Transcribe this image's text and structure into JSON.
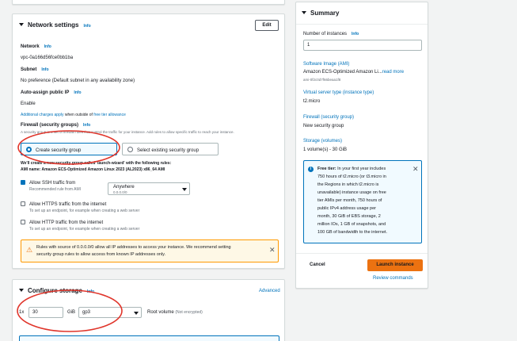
{
  "network": {
    "title": "Network settings",
    "info": "Info",
    "edit_label": "Edit",
    "network_label": "Network",
    "network_value": "vpc-0a166d56fce0bb1ba",
    "subnet_label": "Subnet",
    "subnet_value": "No preference (Default subnet in any availability zone)",
    "public_ip_label": "Auto-assign public IP",
    "public_ip_value": "Enable",
    "charges_link": "Additional charges apply",
    "charges_text": "when outside of",
    "free_tier_link": "free tier allowance",
    "firewall_label": "Firewall (security groups)",
    "firewall_desc": "A security group is a set of firewall rules that control the traffic for your instance. Add rules to allow specific traffic to reach your instance.",
    "create_sg_label": "Create security group",
    "select_sg_label": "Select existing security group",
    "rules_intro_line1": "We'll create a new security group called 'launch-wizard' with the following rules:",
    "rules_intro_line2": "AMI name: Amazon ECS-Optimized Amazon Linux 2023 (AL2023) x86_64 AMI",
    "ssh_label": "Allow SSH traffic from",
    "ssh_desc": "Recommended rule from AMI",
    "ssh_source_value": "Anywhere",
    "ssh_source_cidr": "0.0.0.0/0",
    "https_label": "Allow HTTPS traffic from the internet",
    "https_desc": "To set up an endpoint, for example when creating a web server",
    "http_label": "Allow HTTP traffic from the internet",
    "http_desc": "To set up an endpoint, for example when creating a web server",
    "warning_text_1": "Rules with source of 0.0.0.0/0 allow all IP addresses to access your instance. We recommend setting",
    "warning_text_2": "security group rules to allow access from known IP addresses only."
  },
  "storage": {
    "title": "Configure storage",
    "info": "Info",
    "advanced_label": "Advanced",
    "multiplier": "1x",
    "size_value": "30",
    "unit": "GiB",
    "type_value": "gp3",
    "root_label": "Root volume",
    "root_note": "(Not encrypted)"
  },
  "summary": {
    "title": "Summary",
    "instances_label": "Number of instances",
    "instances_info": "Info",
    "instances_value": "1",
    "ami_label": "Software Image (AMI)",
    "ami_value": "Amazon ECS-Optimized Amazon Li...",
    "ami_more": "read more",
    "ami_id": "ami-0f2c0d7f66beaa1f8",
    "type_label": "Virtual server type (instance type)",
    "type_value": "t2.micro",
    "firewall_label": "Firewall (security group)",
    "firewall_value": "New security group",
    "storage_label": "Storage (volumes)",
    "storage_value": "1 volume(s) - 30 GiB",
    "free_tier_title": "Free tier:",
    "free_tier_lines": [
      "In your first year includes",
      "750 hours of t2.micro (or t3.micro in",
      "the Regions in which t2.micro is",
      "unavailable) instance usage on free",
      "tier AMIs per month, 750 hours of",
      "public IPv4 address usage per",
      "month, 30 GiB of EBS storage, 2",
      "million IOs, 1 GB of snapshots, and",
      "100 GB of bandwidth to the internet."
    ],
    "cancel_label": "Cancel",
    "launch_label": "Launch instance",
    "review_label": "Review commands"
  },
  "colors": {
    "accent": "#0073bb",
    "primary_button": "#ec7211",
    "annotation": "#e0352b",
    "warning_bg": "#fef8e6",
    "info_bg": "#f1faff"
  }
}
